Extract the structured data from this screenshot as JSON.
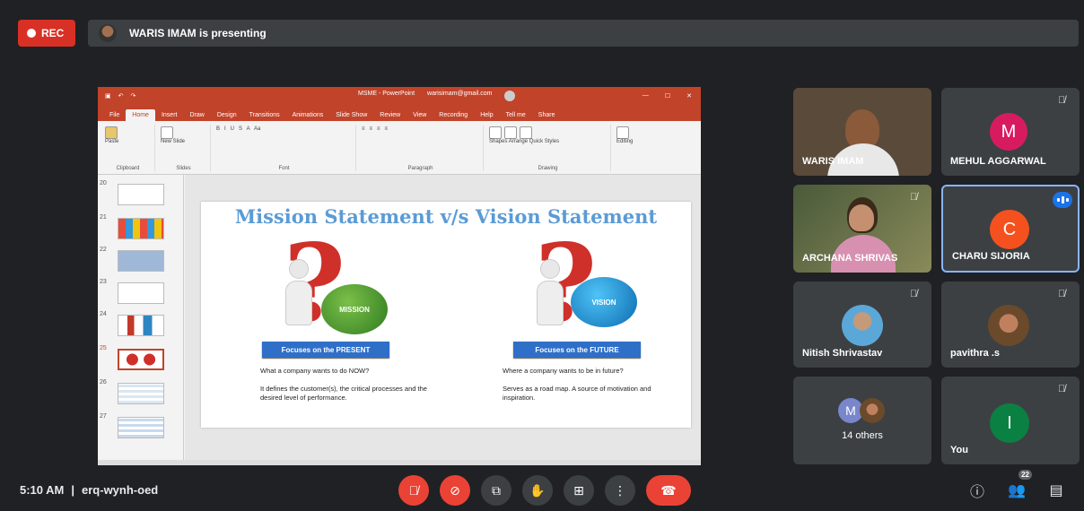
{
  "rec": {
    "label": "REC",
    "color": "#d93025"
  },
  "presenter_bar": {
    "text": "WARIS IMAM is presenting"
  },
  "ppt": {
    "title": "MSME - PowerPoint",
    "account": "warisimam@gmail.com",
    "tabs": [
      "File",
      "Home",
      "Insert",
      "Draw",
      "Design",
      "Transitions",
      "Animations",
      "Slide Show",
      "Review",
      "View",
      "Recording",
      "Help",
      "Tell me",
      "Share"
    ],
    "active_tab": "Home",
    "ribbon_groups": {
      "clipboard": "Clipboard",
      "slides": "Slides",
      "font": "Font",
      "paragraph": "Paragraph",
      "drawing": "Drawing",
      "editing": "Editing"
    },
    "ribbon_buttons": {
      "paste": "Paste",
      "new_slide": "New Slide",
      "shapes": "Shapes",
      "arrange": "Arrange",
      "quick_styles": "Quick Styles",
      "editing": "Editing"
    },
    "thumb_numbers": [
      "20",
      "21",
      "22",
      "23",
      "24",
      "25",
      "26",
      "27"
    ],
    "selected_thumb": "25",
    "slide": {
      "title": "Mission Statement v/s Vision Statement",
      "left": {
        "ball": "MISSION",
        "button": "Focuses on the PRESENT",
        "line1": "What a company wants to do NOW?",
        "line2": "It defines the customer(s), the critical processes and the desired level of performance."
      },
      "right": {
        "ball": "VISION",
        "button": "Focuses on the FUTURE",
        "line1": "Where a company wants to be in future?",
        "line2": "Serves as a road map. A source of motivation and inspiration."
      }
    }
  },
  "participants": {
    "waris": {
      "name": "WARIS IMAM"
    },
    "mehul": {
      "name": "MEHUL AGGARWAL",
      "initial": "M",
      "color": "#d81b60"
    },
    "archana": {
      "name": "ARCHANA SHRIVAS"
    },
    "charu": {
      "name": "CHARU SIJORIA",
      "initial": "C",
      "color": "#f4511e"
    },
    "nitish": {
      "name": "Nitish Shrivastav"
    },
    "pavithra": {
      "name": "pavithra .s"
    },
    "others": {
      "name": "14 others",
      "initial": "M",
      "color": "#7986cb"
    },
    "you": {
      "name": "You",
      "initial": "I",
      "color": "#0b8043"
    }
  },
  "meeting": {
    "time": "5:10 AM",
    "separator": "|",
    "code": "erq-wynh-oed"
  },
  "people_count": "22",
  "icons": {
    "mic_off": "mic-off-icon",
    "cam_off": "camera-off-icon",
    "captions": "captions-icon",
    "raise_hand": "raise-hand-icon",
    "present": "present-icon",
    "more": "more-options-icon",
    "hangup": "hangup-icon",
    "info": "info-icon",
    "people": "people-icon",
    "chat": "chat-icon"
  }
}
